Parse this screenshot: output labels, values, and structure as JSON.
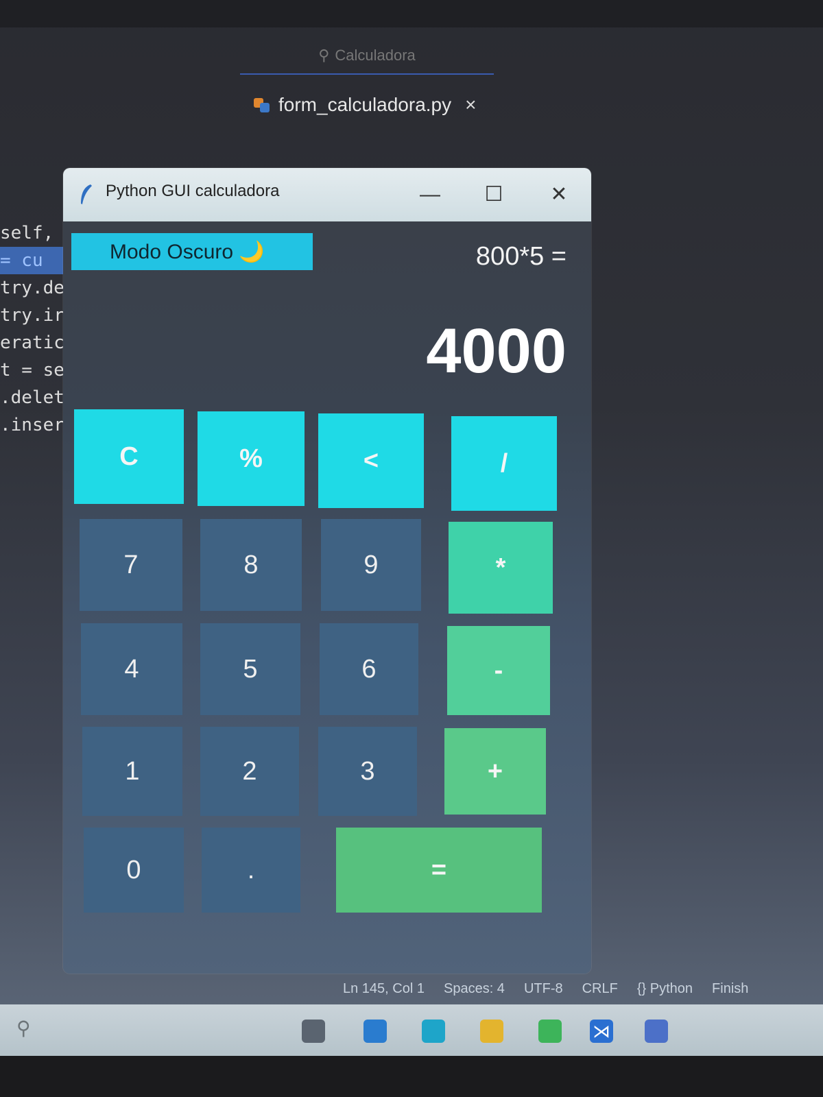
{
  "vscode": {
    "search_text": "Calculadora",
    "tab_filename": "form_calculadora.py",
    "tab_close": "×",
    "code_fragments": [
      "self,",
      "= cu",
      "try.de",
      "try.ir",
      "eratic",
      "",
      "t = se",
      ".delete",
      ".insert"
    ],
    "status": {
      "position": "Ln 145, Col 1",
      "spaces": "Spaces: 4",
      "encoding": "UTF-8",
      "eol": "CRLF",
      "language": "{} Python",
      "finish": "Finish"
    }
  },
  "calculator": {
    "window_title": "Python GUI calculadora",
    "controls": {
      "minimize": "—",
      "maximize": "☐",
      "close": "✕"
    },
    "mode_button": "Modo Oscuro 🌙",
    "expression": "800*5 =",
    "result": "4000",
    "keys": {
      "clear": "C",
      "percent": "%",
      "back": "<",
      "divide": "/",
      "seven": "7",
      "eight": "8",
      "nine": "9",
      "multiply": "*",
      "four": "4",
      "five": "5",
      "six": "6",
      "minus": "-",
      "one": "1",
      "two": "2",
      "three": "3",
      "plus": "+",
      "zero": "0",
      "dot": ".",
      "equals": "="
    }
  },
  "colors": {
    "accent_cyan": "#1fdae6",
    "number_key": "#3f6283",
    "operator_green": "#57c17e"
  }
}
